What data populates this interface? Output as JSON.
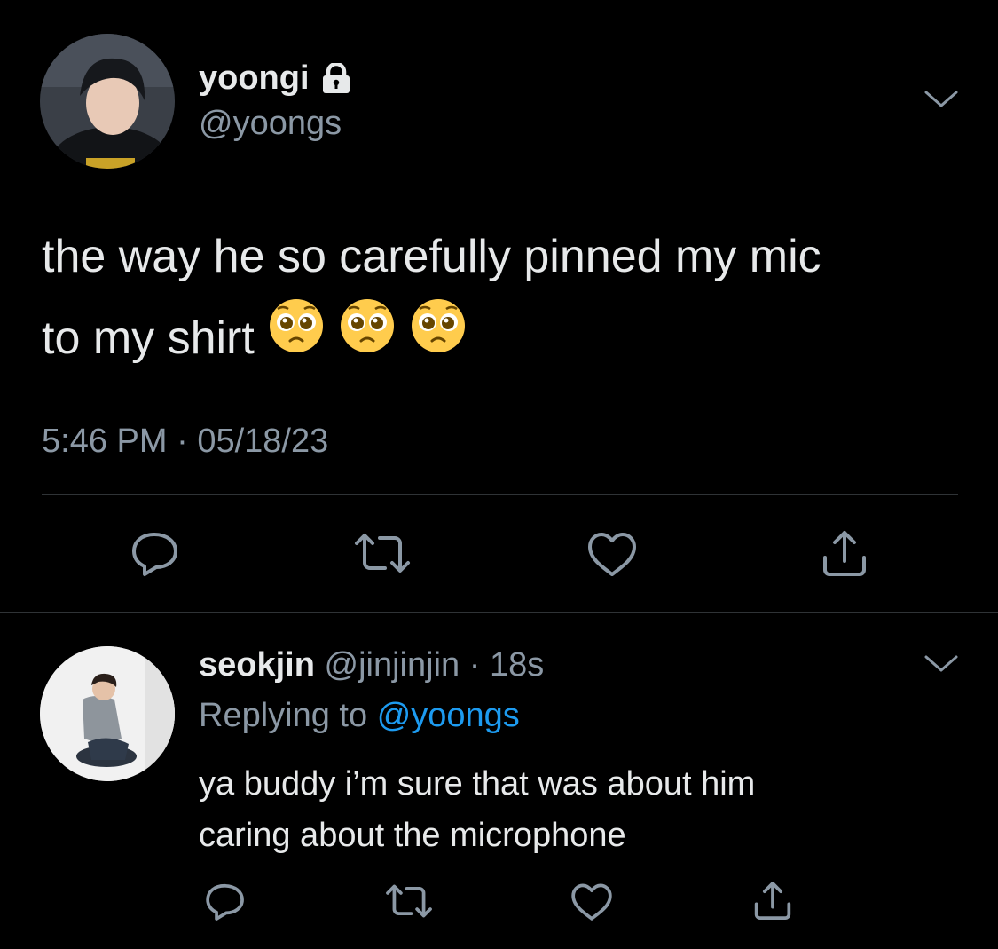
{
  "tweet": {
    "display_name": "yoongi",
    "handle": "@yoongs",
    "text_line1": "the way he so carefully pinned my mic",
    "text_line2": "to my shirt",
    "emojis": [
      "pleading-face",
      "pleading-face",
      "pleading-face"
    ],
    "time": "5:46 PM",
    "separator": "·",
    "date": "05/18/23"
  },
  "reply": {
    "display_name": "seokjin",
    "handle": "@jinjinjin",
    "separator": "·",
    "age": "18s",
    "replying_prefix": "Replying to",
    "replying_handle": "@yoongs",
    "text_line1": "ya buddy i’m sure that was about him",
    "text_line2": "caring about the microphone"
  },
  "colors": {
    "background": "#000000",
    "text": "#e7e9ea",
    "secondary": "#8b98a5",
    "link": "#1d9bf0",
    "divider": "#2f3336"
  },
  "icons": {
    "lock": "lock-icon",
    "chevron": "chevron-down-icon",
    "reply": "reply-icon",
    "retweet": "retweet-icon",
    "like": "heart-icon",
    "share": "share-icon"
  }
}
